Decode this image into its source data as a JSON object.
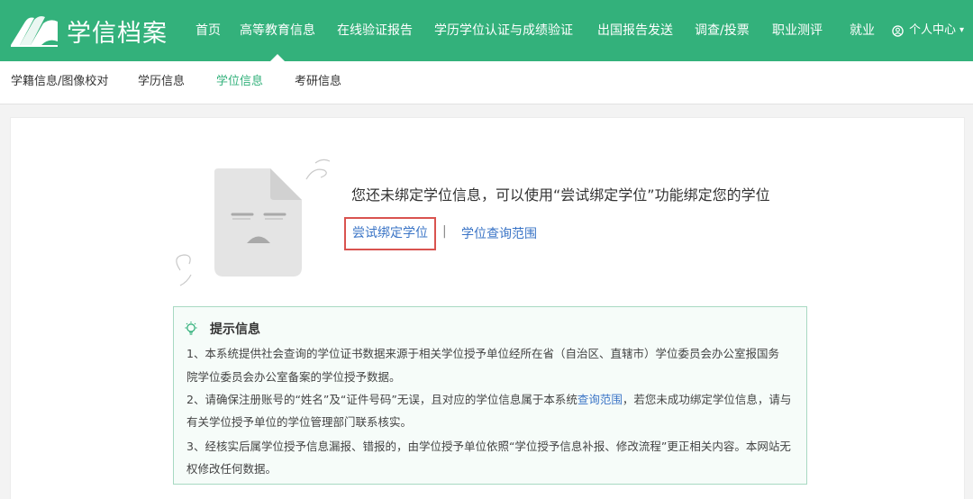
{
  "brand": {
    "name": "学信档案"
  },
  "nav": {
    "items": [
      {
        "label": "首页"
      },
      {
        "label": "高等教育信息"
      },
      {
        "label": "在线验证报告"
      },
      {
        "label": "学历学位认证与成绩验证"
      },
      {
        "label": "出国报告发送"
      },
      {
        "label": "调查/投票"
      },
      {
        "label": "职业测评"
      },
      {
        "label": "就业"
      }
    ],
    "user_label": "个人中心"
  },
  "subnav": {
    "items": [
      {
        "label": "学籍信息/图像校对"
      },
      {
        "label": "学历信息"
      },
      {
        "label": "学位信息"
      },
      {
        "label": "考研信息"
      }
    ]
  },
  "empty_state": {
    "message": "您还未绑定学位信息，可以使用“尝试绑定学位”功能绑定您的学位",
    "bind_label": "尝试绑定学位",
    "separator": "|",
    "scope_label": "学位查询范围"
  },
  "tips": {
    "title": "提示信息",
    "line1": "1、本系统提供社会查询的学位证书数据来源于相关学位授予单位经所在省（自治区、直辖市）学位委员会办公室报国务",
    "line1b": "院学位委员会办公室备案的学位授予数据。",
    "line2a": "2、请确保注册账号的“姓名”及“证件号码”无误，且对应的学位信息属于本系统",
    "line2_link": "查询范围",
    "line2c": "，若您未成功绑定学位信息，请与",
    "line2b": "有关学位授予单位的学位管理部门联系核实。",
    "line3": "3、经核实后属学位授予信息漏报、错报的，由学位授予单位依照“学位授予信息补报、修改流程”更正相关内容。本网站无",
    "line3b": "权修改任何数据。"
  },
  "colors": {
    "brand_green": "#33b17b",
    "link_blue": "#3a74c6",
    "highlight_red": "#d9534f"
  }
}
